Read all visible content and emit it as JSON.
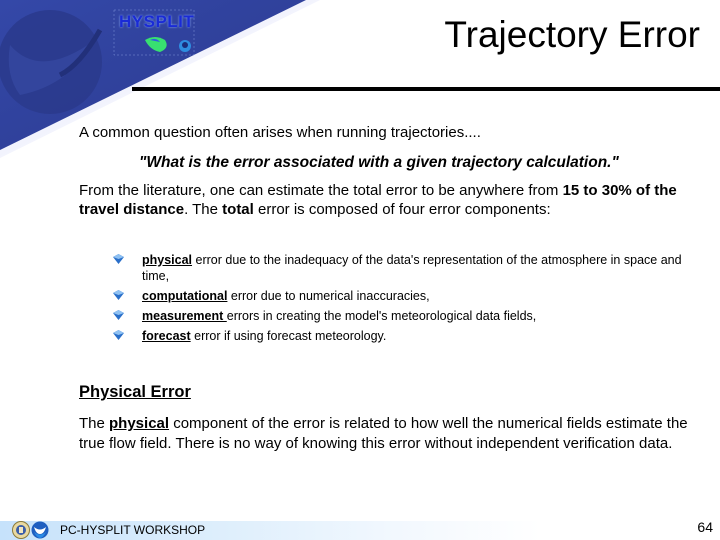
{
  "slide": {
    "title": "Trajectory Error",
    "logo_text": "HYSPLIT",
    "intro": "A common question often arises when running trajectories....",
    "quote": "\"What is the error associated with a given trajectory calculation.\"",
    "para": {
      "part1": "From the literature, one can estimate the total error to be anywhere from ",
      "bold1": "15 to 30% of the travel distance",
      "part2": ". The ",
      "bold2": "total",
      "part3": " error is composed of four error components:"
    },
    "bullets": [
      {
        "keyword": "physical",
        "text": " error due to the inadequacy of the data's representation of the atmosphere in space and time,"
      },
      {
        "keyword": "computational",
        "text": " error due to numerical inaccuracies,"
      },
      {
        "keyword": "measurement ",
        "text": "errors in creating the model's meteorological data fields,"
      },
      {
        "keyword": "forecast",
        "text": " error if using forecast meteorology."
      }
    ],
    "section_heading": "Physical Error",
    "body": {
      "part1": "The ",
      "keyword": "physical",
      "part2": " component of the error is related to how well the numerical fields estimate the true flow field. There is no way of knowing this error without independent verification data."
    }
  },
  "footer": {
    "workshop": "PC-HYSPLIT WORKSHOP",
    "page_number": "64"
  },
  "colors": {
    "header_blue": "#2f3f96",
    "logo_text": "#1a2bd6",
    "bullet_blue": "#2a6fc9"
  }
}
